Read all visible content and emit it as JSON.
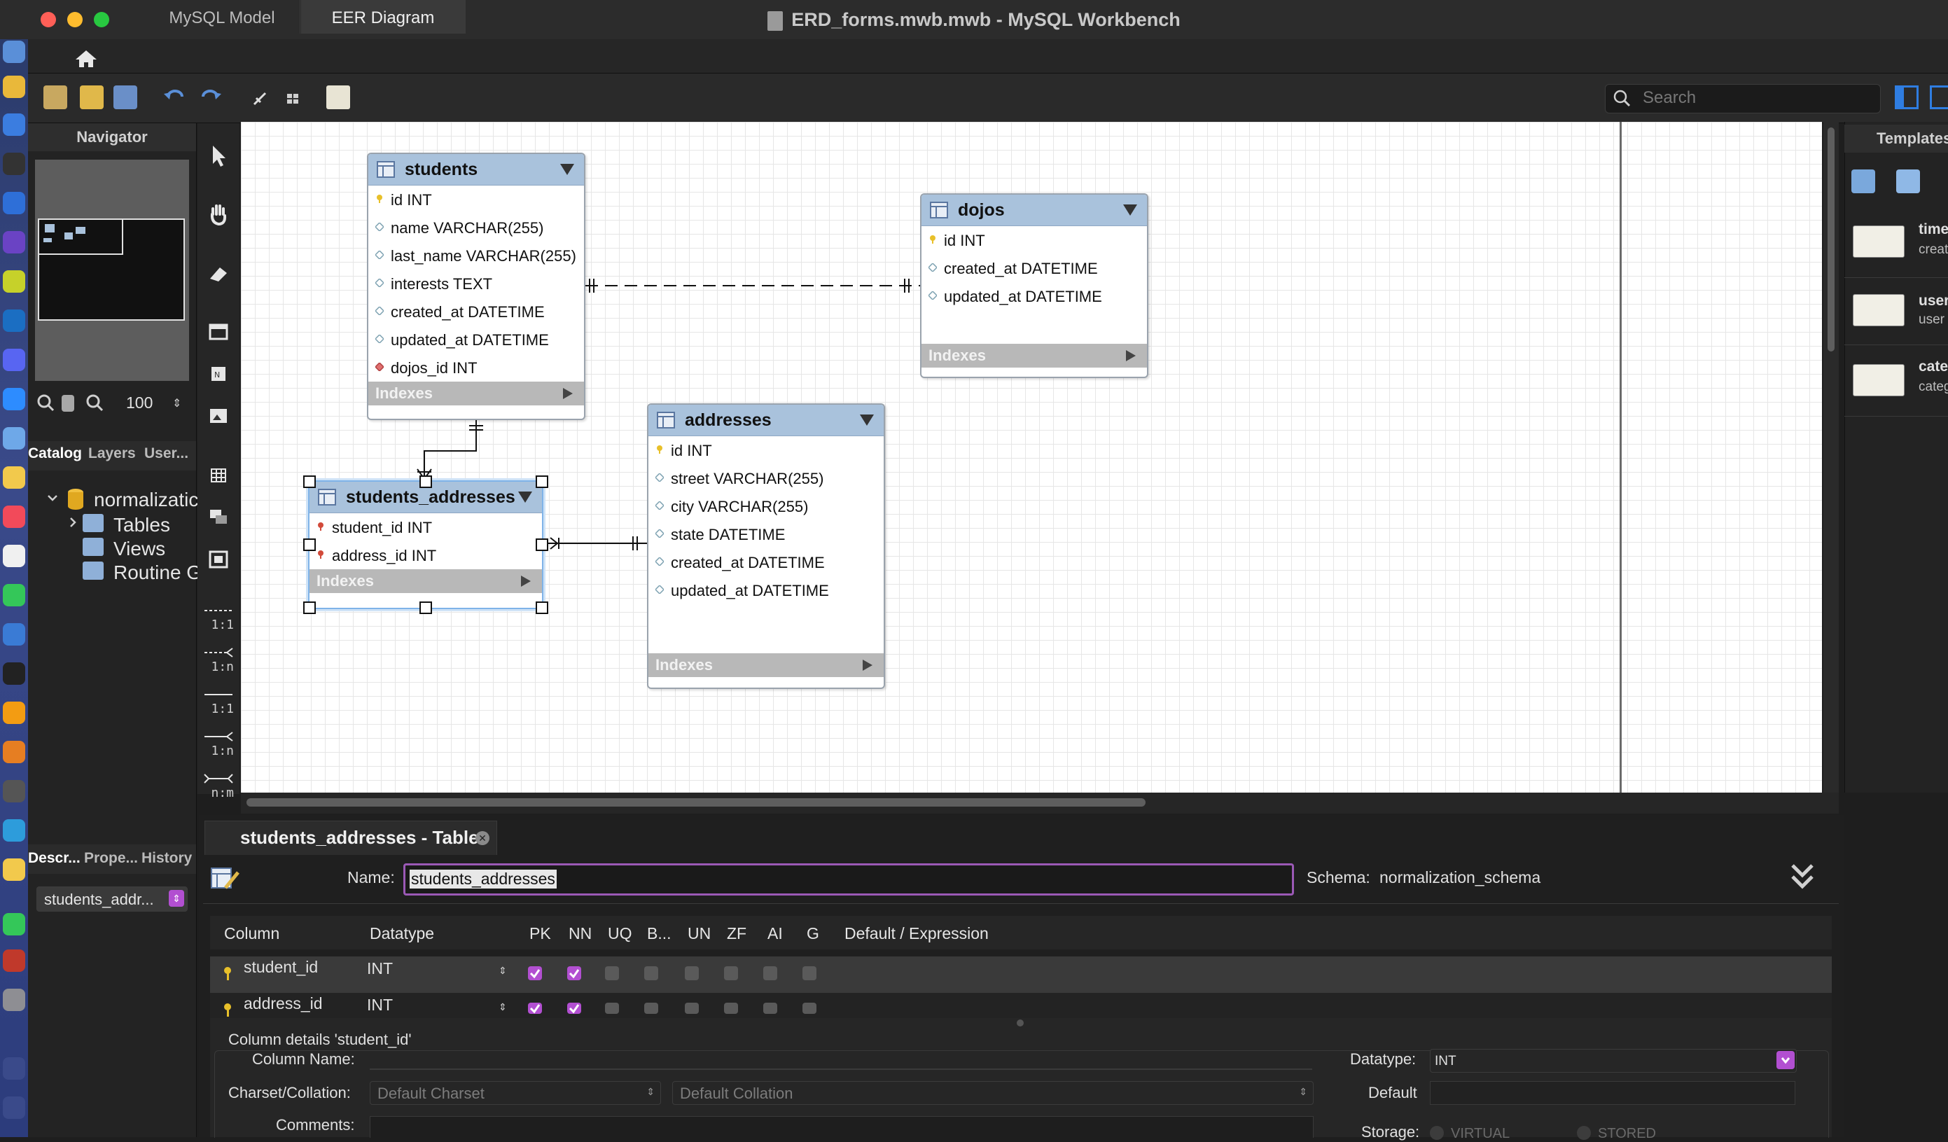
{
  "window": {
    "title": "ERD_forms.mwb.mwb - MySQL Workbench"
  },
  "tabs": [
    {
      "label": "MySQL Model"
    },
    {
      "label": "EER Diagram"
    }
  ],
  "toolbar": {
    "search_placeholder": "Search"
  },
  "navigator": {
    "title": "Navigator",
    "zoom": "100"
  },
  "catalog": {
    "tabs": [
      "Catalog",
      "Layers",
      "User..."
    ],
    "schema": "normalizatic",
    "items": [
      "Tables",
      "Views",
      "Routine G"
    ]
  },
  "lower_left": {
    "tabs": [
      "Descr...",
      "Prope...",
      "History"
    ],
    "selected": "students_addr..."
  },
  "tool_labels": [
    "1:1",
    "1:n",
    "1:1",
    "1:n",
    "n:m"
  ],
  "diagram": {
    "tables": [
      {
        "name": "students",
        "columns": [
          {
            "text": "id INT",
            "kind": "pk"
          },
          {
            "text": "name VARCHAR(255)",
            "kind": "col"
          },
          {
            "text": "last_name VARCHAR(255)",
            "kind": "col"
          },
          {
            "text": "interests TEXT",
            "kind": "col"
          },
          {
            "text": "created_at DATETIME",
            "kind": "col"
          },
          {
            "text": "updated_at DATETIME",
            "kind": "col"
          },
          {
            "text": "dojos_id INT",
            "kind": "fk"
          }
        ],
        "indexes_label": "Indexes"
      },
      {
        "name": "dojos",
        "columns": [
          {
            "text": "id INT",
            "kind": "pk"
          },
          {
            "text": "created_at DATETIME",
            "kind": "col"
          },
          {
            "text": "updated_at DATETIME",
            "kind": "col"
          }
        ],
        "indexes_label": "Indexes"
      },
      {
        "name": "addresses",
        "columns": [
          {
            "text": "id INT",
            "kind": "pk"
          },
          {
            "text": "street VARCHAR(255)",
            "kind": "col"
          },
          {
            "text": "city VARCHAR(255)",
            "kind": "col"
          },
          {
            "text": "state DATETIME",
            "kind": "col"
          },
          {
            "text": "created_at DATETIME",
            "kind": "col"
          },
          {
            "text": "updated_at DATETIME",
            "kind": "col"
          }
        ],
        "indexes_label": "Indexes"
      },
      {
        "name": "students_addresses",
        "columns": [
          {
            "text": "student_id INT",
            "kind": "pkfk"
          },
          {
            "text": "address_id INT",
            "kind": "pkfk"
          }
        ],
        "indexes_label": "Indexes"
      }
    ]
  },
  "templates": {
    "title": "Templates",
    "items": [
      {
        "title": "time",
        "sub": "creat"
      },
      {
        "title": "user",
        "sub": "user"
      },
      {
        "title": "cate",
        "sub": "categ"
      }
    ]
  },
  "editor": {
    "tab_title": "students_addresses - Table",
    "name_label": "Name:",
    "name_value": "students_addresses",
    "schema_label": "Schema:",
    "schema_value": "normalization_schema",
    "grid_headers": [
      "Column",
      "Datatype",
      "PK",
      "NN",
      "UQ",
      "B...",
      "UN",
      "ZF",
      "AI",
      "G",
      "Default / Expression"
    ],
    "rows": [
      {
        "column": "student_id",
        "datatype": "INT",
        "pk": true,
        "nn": true
      },
      {
        "column": "address_id",
        "datatype": "INT",
        "pk": true,
        "nn": true
      }
    ],
    "details_title": "Column details 'student_id'",
    "column_name_label": "Column Name:",
    "charset_label": "Charset/Collation:",
    "charset_value": "Default Charset",
    "collation_value": "Default Collation",
    "comments_label": "Comments:",
    "datatype_label": "Datatype:",
    "datatype_value": "INT",
    "default_label": "Default",
    "storage_label": "Storage:",
    "storage_options": [
      "VIRTUAL",
      "STORED"
    ]
  },
  "colors": {
    "accent": "#b24fd1",
    "table_header": "#a9c2dc",
    "canvas": "#ffffff"
  }
}
